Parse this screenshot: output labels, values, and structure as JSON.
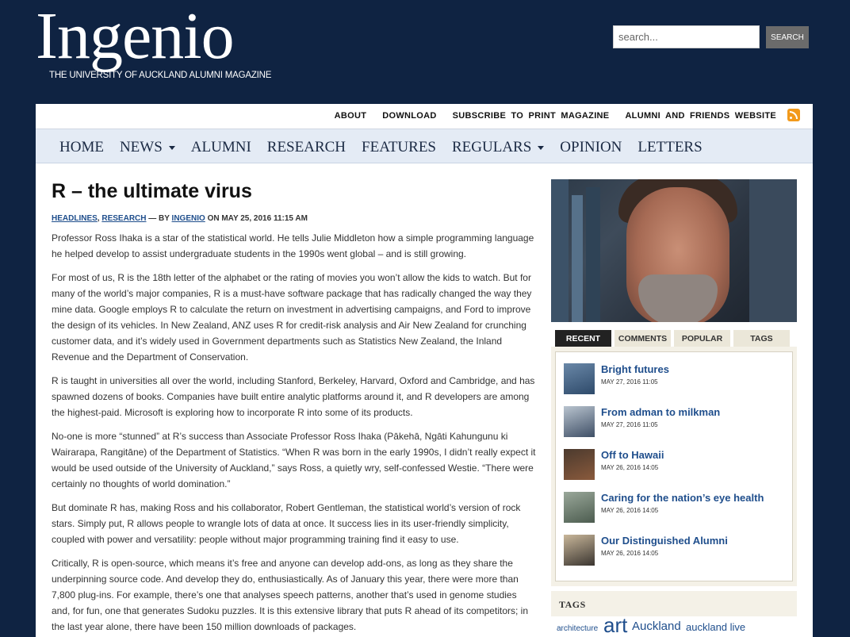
{
  "masthead": {
    "logo": "Ingenio",
    "tagline": "THE UNIVERSITY OF AUCKLAND ALUMNI MAGAZINE",
    "search_placeholder": "search...",
    "search_button": "SEARCH"
  },
  "topbar": {
    "links": [
      "ABOUT",
      "DOWNLOAD",
      "SUBSCRIBE TO PRINT MAGAZINE",
      "ALUMNI AND FRIENDS WEBSITE"
    ]
  },
  "nav": {
    "items": [
      "HOME",
      "NEWS",
      "ALUMNI",
      "RESEARCH",
      "FEATURES",
      "REGULARS",
      "OPINION",
      "LETTERS"
    ]
  },
  "article": {
    "title": "R – the ultimate virus",
    "category1": "HEADLINES",
    "category2": "RESEARCH",
    "by": "— BY",
    "author": "INGENIO",
    "date": "ON MAY 25, 2016 11:15 AM",
    "paragraphs": [
      "Professor Ross Ihaka is a star of the statistical world. He tells Julie Middleton how a simple programming language he helped develop to assist undergraduate students in the 1990s went global – and is still growing.",
      "For most of us, R is the 18th letter of the alphabet or the rating of movies you won’t allow the kids to watch. But for many of the world’s major companies, R is a must-have software package that has radically changed the way they mine data. Google employs R to calculate the return on investment in advertising campaigns, and Ford to improve the design of its vehicles. In New Zealand, ANZ uses R for credit-risk analysis and Air New Zealand for crunching customer data, and it’s widely used in Government departments such as Statistics New Zealand, the Inland Revenue and the Department of Conservation.",
      "R is taught in universities all over the world, including Stanford, Berkeley, Harvard, Oxford and Cambridge, and has spawned dozens of books. Companies have built entire analytic platforms around it, and R developers are among the highest-paid. Microsoft is exploring how to incorporate R into some of its products.",
      "No-one is more “stunned” at R’s success than Associate Professor Ross Ihaka (Pākehā, Ngāti Kahungunu ki Wairarapa, Rangitāne) of the Department of Statistics. “When R was born in the early 1990s, I didn’t really expect it would be used outside of the University of Auckland,” says Ross, a quietly wry, self-confessed Westie. “There were certainly no thoughts of world domination.”",
      "But dominate R has, making Ross and his collaborator, Robert Gentleman, the statistical world’s version of rock stars. Simply put, R allows people to wrangle lots of data at once. It success lies in its user-friendly simplicity, coupled with power and versatility: people without major programming training find it easy to use.",
      "Critically, R is open-source, which means it’s free and anyone can develop add-ons, as long as they share the underpinning source code. And develop they do, enthusiastically. As of January this year, there were more than 7,800 plug-ins. For example, there’s one that analyses speech patterns, another that’s used in genome studies and, for fun, one that generates Sudoku puzzles. It is this extensive library that puts R ahead of its competitors; in the last year alone, there have been 150 million downloads of packages."
    ]
  },
  "sidebar": {
    "tabs": [
      "RECENT",
      "COMMENTS",
      "POPULAR",
      "TAGS"
    ],
    "recent": [
      {
        "title": "Bright futures",
        "date": "MAY 27, 2016 11:05"
      },
      {
        "title": "From adman to milkman",
        "date": "MAY 27, 2016 11:05"
      },
      {
        "title": "Off to Hawaii",
        "date": "MAY 26, 2016 14:05"
      },
      {
        "title": "Caring for the nation’s eye health",
        "date": "MAY 26, 2016 14:05"
      },
      {
        "title": "Our Distinguished Alumni",
        "date": "MAY 26, 2016 14:05"
      }
    ],
    "tags_heading": "TAGS",
    "tags": [
      "architecture",
      "art",
      "Auckland",
      "auckland live"
    ]
  },
  "colors": {
    "header_bg": "#0f2342",
    "link": "#1f4e8c",
    "nav_bg": "#e4ebf5",
    "rss": "#f29a1c"
  }
}
